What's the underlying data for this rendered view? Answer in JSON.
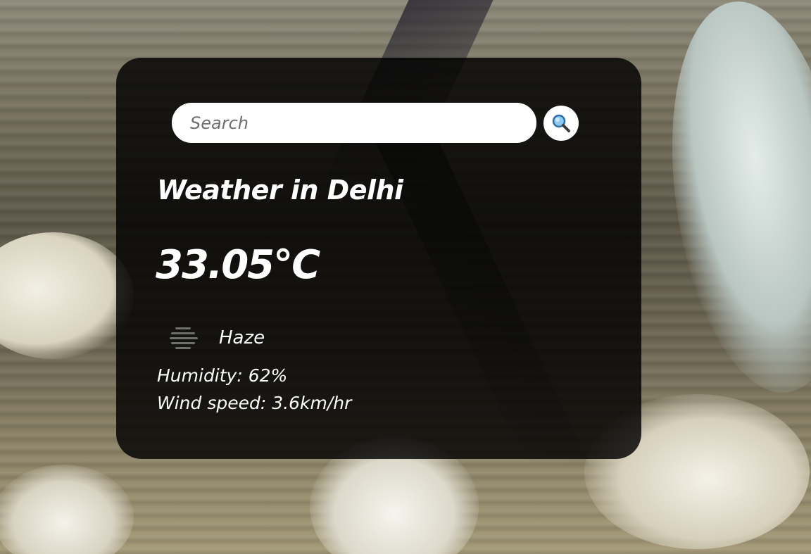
{
  "search": {
    "placeholder": "Search",
    "value": "",
    "button_icon": "magnifier-icon"
  },
  "weather": {
    "title": "Weather in Delhi",
    "temperature": "33.05°C",
    "condition_icon": "haze-icon",
    "description": "Haze",
    "humidity": "Humidity: 62%",
    "wind_speed": "Wind speed: 3.6km/hr"
  },
  "colors": {
    "card_background": "#000000",
    "text": "#ffffff",
    "input_background": "#ffffff",
    "search_icon_lens": "#5aa9e6"
  }
}
